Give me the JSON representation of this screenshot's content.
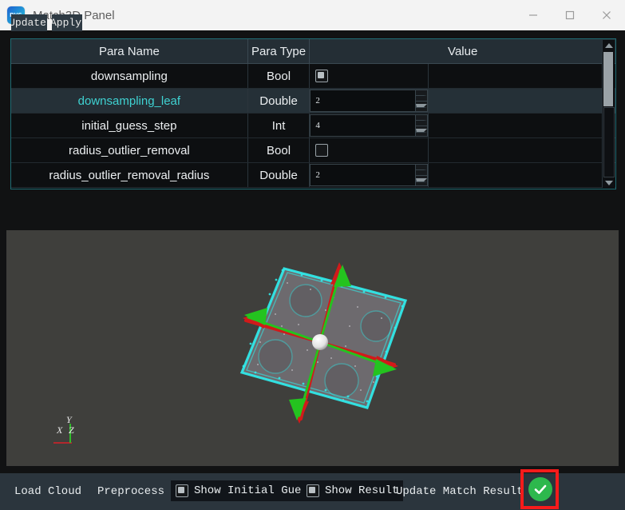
{
  "window": {
    "title": "Match3D Panel",
    "app_icon": "rvs-logo-icon",
    "logo_text": "RVS",
    "controls": {
      "minimize": "minimize-icon",
      "maximize": "maximize-icon",
      "close": "close-icon"
    }
  },
  "toolbar_top": {
    "update_label": "Update",
    "apply_label": "Apply"
  },
  "param_table": {
    "columns": [
      "Para Name",
      "Para Type",
      "Value"
    ],
    "rows": [
      {
        "name": "downsampling",
        "type": "Bool",
        "value": "",
        "control": "checkbox",
        "checked": true,
        "selected": false
      },
      {
        "name": "downsampling_leaf",
        "type": "Double",
        "value": "2",
        "control": "spin",
        "checked": false,
        "selected": true
      },
      {
        "name": "initial_guess_step",
        "type": "Int",
        "value": "4",
        "control": "spin",
        "checked": false,
        "selected": false
      },
      {
        "name": "radius_outlier_removal",
        "type": "Bool",
        "value": "",
        "control": "checkbox",
        "checked": false,
        "selected": false
      },
      {
        "name": "radius_outlier_removal_radius",
        "type": "Double",
        "value": "2",
        "control": "spin",
        "checked": false,
        "selected": false
      }
    ],
    "scrollbar": {
      "up_icon": "scroll-up-arrow-icon",
      "down_icon": "scroll-down-arrow-icon"
    }
  },
  "viewport": {
    "axis_gizmo": {
      "x": "X",
      "y": "Y",
      "z": "Z"
    },
    "colors": {
      "background": "#3f3f3c",
      "cloud_edge": "#2ff0f0",
      "axis_x": "#d92020",
      "axis_y": "#24c31f"
    }
  },
  "toolbar_bottom": {
    "load_cloud_label": "Load Cloud",
    "preprocess_label": "Preprocess",
    "show_initial_guess_label": "Show Initial Guess",
    "show_initial_guess_checked": true,
    "show_result_label": "Show Result",
    "show_result_checked": true,
    "update_match_result_label": "Update Match Result",
    "status_icon": "green-check-circle-icon",
    "annotation_color": "#f61b1b"
  }
}
